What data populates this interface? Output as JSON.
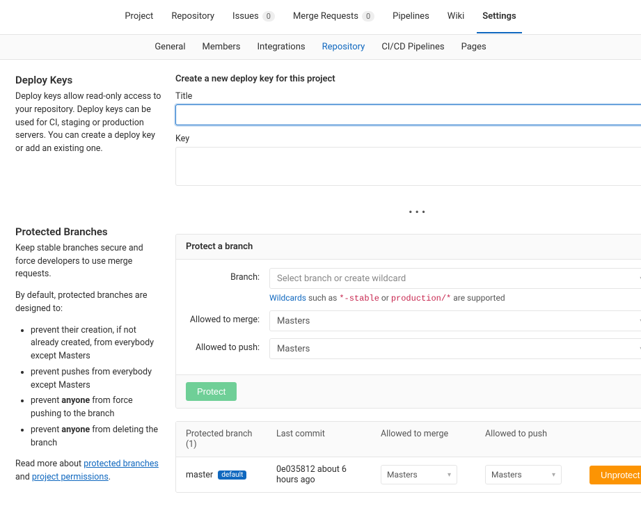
{
  "topnav": {
    "items": [
      {
        "label": "Project"
      },
      {
        "label": "Repository"
      },
      {
        "label": "Issues",
        "count": "0"
      },
      {
        "label": "Merge Requests",
        "count": "0"
      },
      {
        "label": "Pipelines"
      },
      {
        "label": "Wiki"
      },
      {
        "label": "Settings"
      }
    ]
  },
  "subnav": {
    "items": [
      "General",
      "Members",
      "Integrations",
      "Repository",
      "CI/CD Pipelines",
      "Pages"
    ]
  },
  "deploy_keys": {
    "title": "Deploy Keys",
    "description": "Deploy keys allow read-only access to your repository. Deploy keys can be used for CI, staging or production servers. You can create a deploy key or add an existing one.",
    "heading": "Create a new deploy key for this project",
    "title_label": "Title",
    "title_value": "",
    "key_label": "Key",
    "key_value": ""
  },
  "protected": {
    "title": "Protected Branches",
    "intro": "Keep stable branches secure and force developers to use merge requests.",
    "by_default": "By default, protected branches are designed to:",
    "bullets": {
      "b1": {
        "a": "prevent their creation, if not already created, from everybody except Masters"
      },
      "b2": {
        "a": "prevent pushes from everybody except Masters"
      },
      "b3": {
        "a": "prevent ",
        "b": "anyone",
        "c": " from force pushing to the branch"
      },
      "b4": {
        "a": "prevent ",
        "b": "anyone",
        "c": " from deleting the branch"
      }
    },
    "readmore": {
      "a": "Read more about ",
      "b": "protected branches",
      "c": " and ",
      "d": "project permissions",
      "e": "."
    },
    "panel_title": "Protect a branch",
    "branch_label": "Branch:",
    "branch_placeholder": "Select branch or create wildcard",
    "wildcard_hint": {
      "a": "Wildcards",
      "b": " such as ",
      "c": "*-stable",
      "d": " or ",
      "e": "production/*",
      "f": " are supported"
    },
    "allowed_merge_label": "Allowed to merge:",
    "allowed_merge_value": "Masters",
    "allowed_push_label": "Allowed to push:",
    "allowed_push_value": "Masters",
    "protect_btn": "Protect",
    "table": {
      "header": {
        "branch": "Protected branch (1)",
        "commit": "Last commit",
        "merge": "Allowed to merge",
        "push": "Allowed to push"
      },
      "row": {
        "name": "master",
        "default_tag": "default",
        "commit": "0e035812 about 6 hours ago",
        "merge": "Masters",
        "push": "Masters",
        "action": "Unprotect"
      }
    }
  }
}
